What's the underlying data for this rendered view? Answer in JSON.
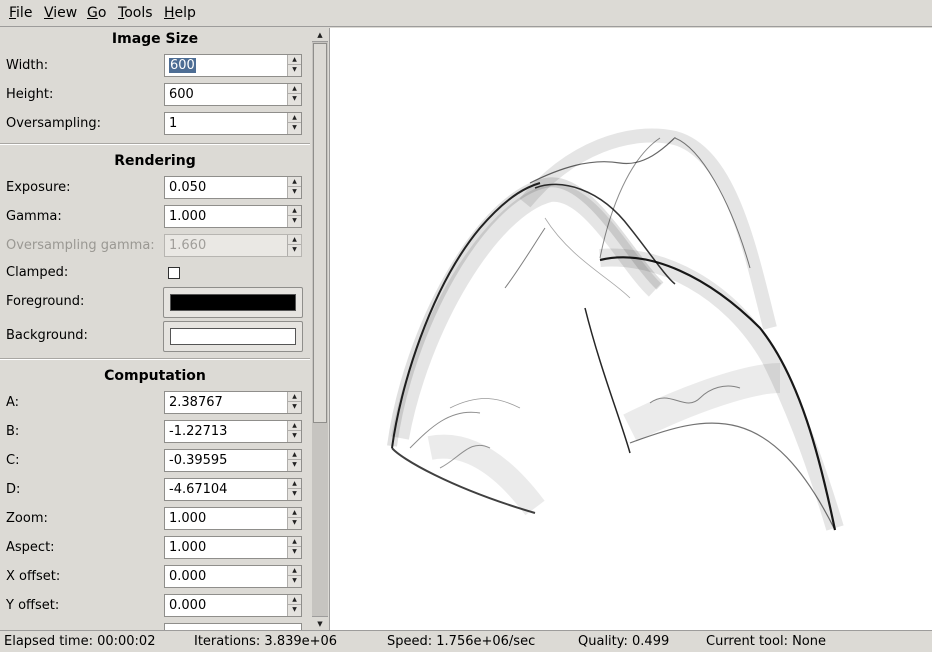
{
  "menu": [
    {
      "accel": "F",
      "rest": "ile"
    },
    {
      "accel": "V",
      "rest": "iew"
    },
    {
      "accel": "G",
      "rest": "o"
    },
    {
      "accel": "T",
      "rest": "ools"
    },
    {
      "accel": "H",
      "rest": "elp"
    }
  ],
  "sidebar": {
    "image_size": {
      "title": "Image Size",
      "width_label": "Width:",
      "width_value": "600",
      "height_label": "Height:",
      "height_value": "600",
      "oversampling_label": "Oversampling:",
      "oversampling_value": "1"
    },
    "rendering": {
      "title": "Rendering",
      "exposure_label": "Exposure:",
      "exposure_value": "0.050",
      "gamma_label": "Gamma:",
      "gamma_value": "1.000",
      "oversampling_gamma_label": "Oversampling gamma:",
      "oversampling_gamma_value": "1.660",
      "clamped_label": "Clamped:",
      "clamped_checked": false,
      "foreground_label": "Foreground:",
      "foreground_color": "#000000",
      "background_label": "Background:",
      "background_color": "#ffffff"
    },
    "computation": {
      "title": "Computation",
      "a_label": "A:",
      "a_value": "2.38767",
      "b_label": "B:",
      "b_value": "-1.22713",
      "c_label": "C:",
      "c_value": "-0.39595",
      "d_label": "D:",
      "d_value": "-4.67104",
      "zoom_label": "Zoom:",
      "zoom_value": "1.000",
      "aspect_label": "Aspect:",
      "aspect_value": "1.000",
      "xoffset_label": "X offset:",
      "xoffset_value": "0.000",
      "yoffset_label": "Y offset:",
      "yoffset_value": "0.000"
    }
  },
  "status": {
    "elapsed": "Elapsed time: 00:00:02",
    "iterations": "Iterations: 3.839e+06",
    "speed": "Speed: 1.756e+06/sec",
    "quality": "Quality: 0.499",
    "tool": "Current tool: None"
  },
  "colors": {
    "window_bg": "#dcdad5",
    "selection": "#4d6d94"
  }
}
